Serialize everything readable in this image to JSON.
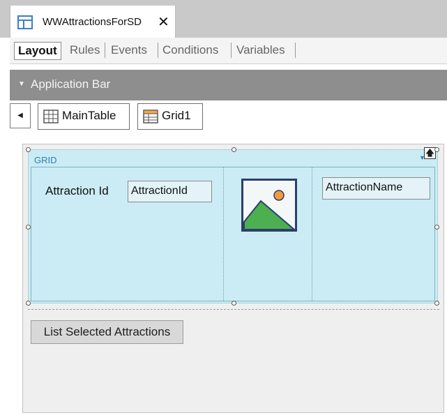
{
  "window": {
    "tab_title": "WWAttractionsForSD",
    "close_glyph": "✕"
  },
  "view_tabs": [
    {
      "label": "Layout",
      "active": true
    },
    {
      "label": "Rules"
    },
    {
      "label": "Events"
    },
    {
      "label": "Conditions"
    },
    {
      "label": "Variables"
    }
  ],
  "app_bar": {
    "label": "Application Bar",
    "arrow_glyph": "▼"
  },
  "breadcrumb": {
    "back_glyph": "◀",
    "items": [
      {
        "label": "MainTable",
        "icon": "table-icon"
      },
      {
        "label": "Grid1",
        "icon": "grid-icon"
      }
    ]
  },
  "grid": {
    "label": "GRID",
    "menu_glyph": "▼",
    "up_glyph": "🡅",
    "attraction_id_label": "Attraction Id",
    "attraction_id_field": "AttractionId",
    "attraction_name_field": "AttractionName",
    "image_icon": "image-placeholder-icon"
  },
  "button": {
    "label": "List Selected Attractions"
  },
  "colors": {
    "grid_bg": "#cbecf4",
    "accent": "#2f7fb0",
    "app_bar": "#8e8e8e"
  }
}
